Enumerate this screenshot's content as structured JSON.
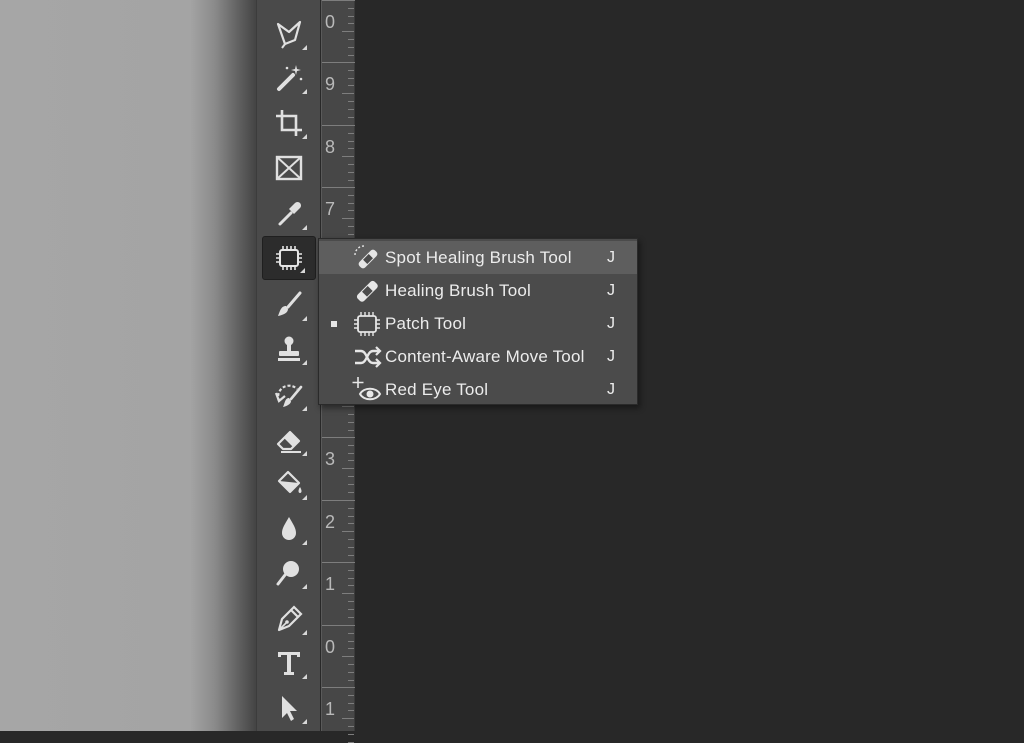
{
  "colors": {
    "toolbar_bg": "#4a4a4a",
    "canvas_bg": "#282828",
    "menu_bg": "#4b4b4b",
    "menu_highlight": "#5e5e5e",
    "text": "#ececec"
  },
  "toolbar": {
    "tools": [
      {
        "name": "polygonal-lasso-tool",
        "icon": "polygonal-lasso-icon"
      },
      {
        "name": "magic-wand-tool",
        "icon": "magic-wand-icon"
      },
      {
        "name": "crop-tool",
        "icon": "crop-icon"
      },
      {
        "name": "frame-tool",
        "icon": "frame-icon"
      },
      {
        "name": "eyedropper-tool",
        "icon": "eyedropper-icon"
      },
      {
        "name": "patch-tool",
        "icon": "patch-icon",
        "active": true
      },
      {
        "name": "brush-tool",
        "icon": "brush-icon"
      },
      {
        "name": "clone-stamp-tool",
        "icon": "stamp-icon"
      },
      {
        "name": "history-brush-tool",
        "icon": "history-brush-icon"
      },
      {
        "name": "eraser-tool",
        "icon": "eraser-icon"
      },
      {
        "name": "paint-bucket-tool",
        "icon": "paint-bucket-icon"
      },
      {
        "name": "blur-tool",
        "icon": "blur-drop-icon"
      },
      {
        "name": "dodge-tool",
        "icon": "dodge-icon"
      },
      {
        "name": "pen-tool",
        "icon": "pen-icon"
      },
      {
        "name": "type-tool",
        "icon": "type-icon"
      },
      {
        "name": "path-selection-tool",
        "icon": "arrow-icon"
      }
    ]
  },
  "ruler": {
    "labels": [
      "0",
      "9",
      "8",
      "7",
      "3",
      "2",
      "1",
      "0",
      "1"
    ]
  },
  "flyout_menu": {
    "items": [
      {
        "label": "Spot Healing Brush Tool",
        "shortcut": "J",
        "icon": "spot-healing-icon",
        "highlighted": true,
        "selected": false
      },
      {
        "label": "Healing Brush Tool",
        "shortcut": "J",
        "icon": "healing-brush-icon",
        "highlighted": false,
        "selected": false
      },
      {
        "label": "Patch Tool",
        "shortcut": "J",
        "icon": "patch-icon",
        "highlighted": false,
        "selected": true
      },
      {
        "label": "Content-Aware Move Tool",
        "shortcut": "J",
        "icon": "content-aware-move-icon",
        "highlighted": false,
        "selected": false
      },
      {
        "label": "Red Eye Tool",
        "shortcut": "J",
        "icon": "red-eye-icon",
        "highlighted": false,
        "selected": false
      }
    ]
  }
}
